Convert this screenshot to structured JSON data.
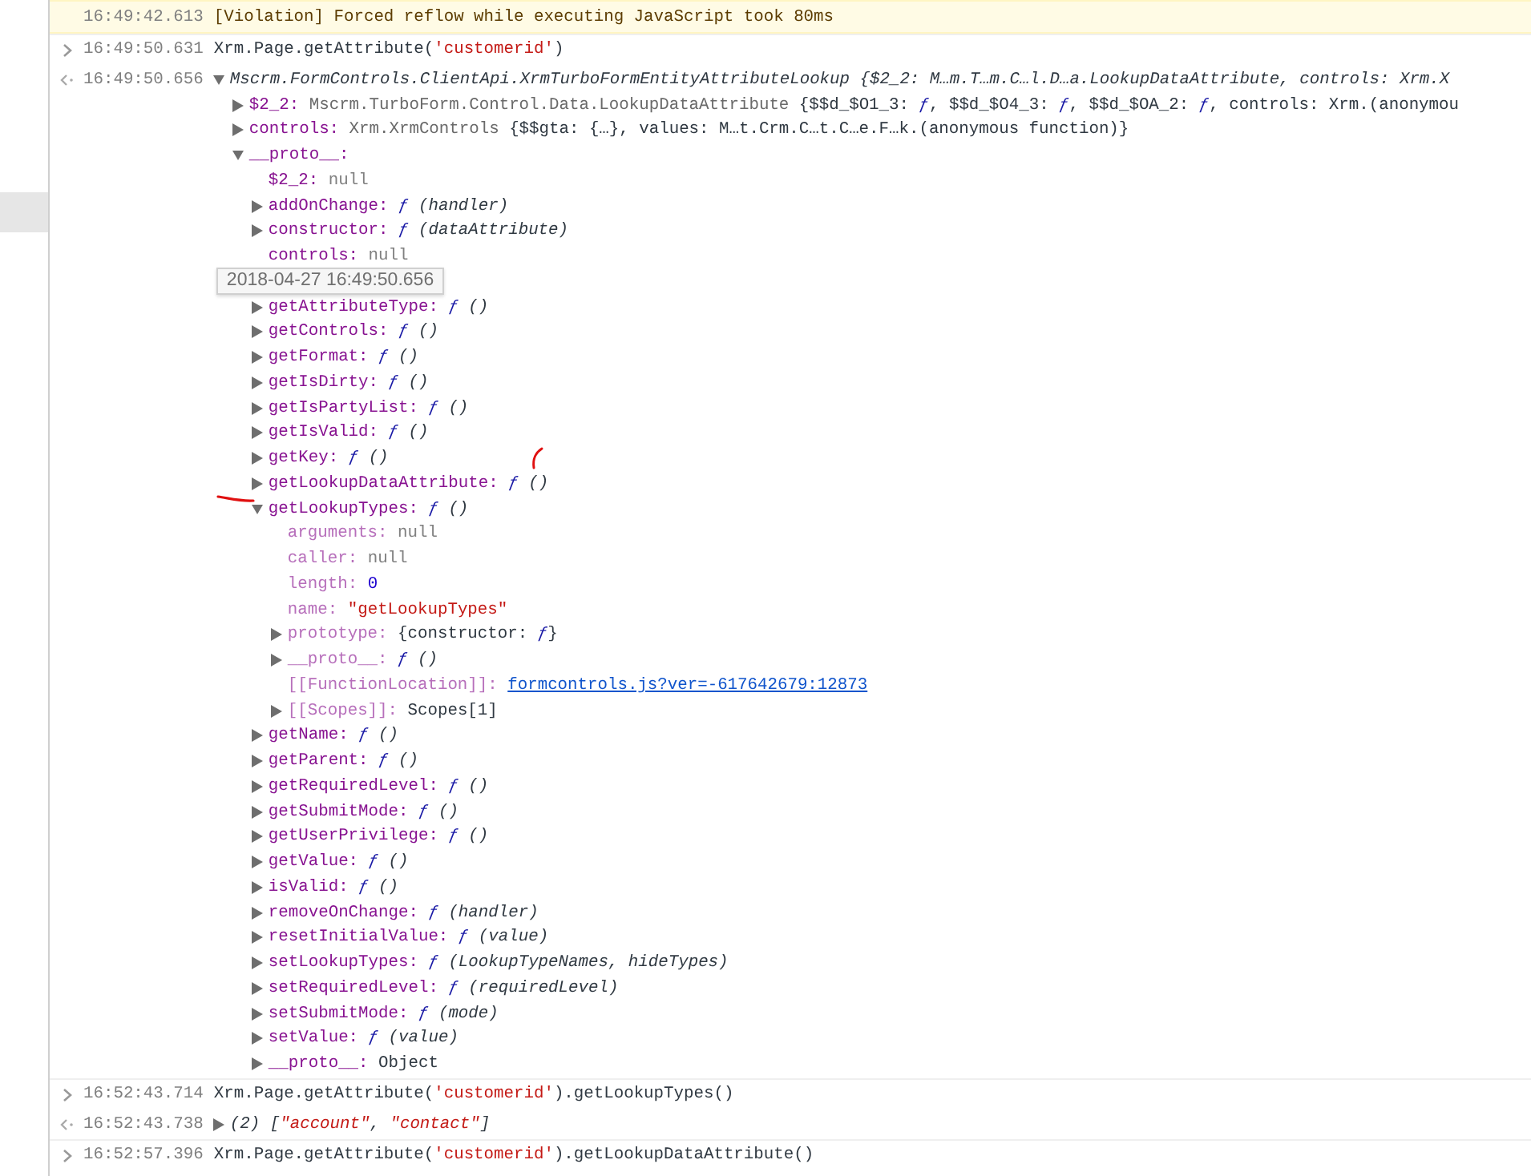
{
  "console": {
    "messages": [
      {
        "kind": "violation",
        "time": "16:49:42.613",
        "tokens": [
          {
            "kind": "plain",
            "text": "[Violation] Forced reflow while executing JavaScript took 80ms"
          }
        ]
      },
      {
        "kind": "input",
        "time": "16:49:50.631",
        "tokens": [
          {
            "kind": "plain",
            "text": "Xrm.Page.getAttribute("
          },
          {
            "kind": "string",
            "text": "'customerid'"
          },
          {
            "kind": "plain",
            "text": ")"
          }
        ]
      },
      {
        "kind": "output",
        "time": "16:49:50.656",
        "tree": {
          "expanded": true,
          "tokens": [
            {
              "kind": "plain",
              "text": "Mscrm.FormControls.ClientApi.XrmTurboFormEntityAttributeLookup {$2_2: M…m.T…m.C…l.D…a.LookupDataAttribute, controls: Xrm.X"
            }
          ],
          "children": [
            {
              "key": "$2_2:",
              "kind": "branch",
              "expanded": false,
              "faint": false,
              "value": [
                {
                  "kind": "class",
                  "text": "Mscrm.TurboForm.Control.Data.LookupDataAttribute"
                },
                {
                  "kind": "plain",
                  "text": " {$$d_$O1_3: "
                },
                {
                  "kind": "fn",
                  "text": "ƒ"
                },
                {
                  "kind": "plain",
                  "text": ", $$d_$O4_3: "
                },
                {
                  "kind": "fn",
                  "text": "ƒ"
                },
                {
                  "kind": "plain",
                  "text": ", $$d_$OA_2: "
                },
                {
                  "kind": "fn",
                  "text": "ƒ"
                },
                {
                  "kind": "plain",
                  "text": ", controls: Xrm.(anonymou"
                }
              ]
            },
            {
              "key": "controls:",
              "kind": "branch",
              "expanded": false,
              "faint": false,
              "value": [
                {
                  "kind": "class",
                  "text": "Xrm.XrmControls"
                },
                {
                  "kind": "plain",
                  "text": " {$$gta: {…}, values: M…t.Crm.C…t.C…e.F…k.(anonymous function)}"
                }
              ]
            },
            {
              "key": "__proto__:",
              "kind": "branch",
              "expanded": true,
              "faint": false,
              "children": [
                {
                  "key": "$2_2:",
                  "kind": "leaf",
                  "faint": false,
                  "value": [
                    {
                      "kind": "null",
                      "text": "null"
                    }
                  ]
                },
                {
                  "key": "addOnChange:",
                  "kind": "branch",
                  "expanded": false,
                  "faint": false,
                  "value": [
                    {
                      "kind": "fn",
                      "text": "ƒ"
                    },
                    {
                      "kind": "params",
                      "text": " (handler)"
                    }
                  ]
                },
                {
                  "key": "constructor:",
                  "kind": "branch",
                  "expanded": false,
                  "faint": false,
                  "value": [
                    {
                      "kind": "fn",
                      "text": "ƒ"
                    },
                    {
                      "kind": "params",
                      "text": " (dataAttribute)"
                    }
                  ]
                },
                {
                  "key": "controls:",
                  "kind": "leaf",
                  "faint": false,
                  "value": [
                    {
                      "kind": "null",
                      "text": "null"
                    }
                  ]
                },
                {
                  "kind": "tooltip",
                  "text": "2018-04-27 16:49:50.656"
                },
                {
                  "key": "getAttributeType:",
                  "kind": "branch",
                  "expanded": false,
                  "faint": false,
                  "value": [
                    {
                      "kind": "fn",
                      "text": "ƒ"
                    },
                    {
                      "kind": "params",
                      "text": " ()"
                    }
                  ]
                },
                {
                  "key": "getControls:",
                  "kind": "branch",
                  "expanded": false,
                  "faint": false,
                  "value": [
                    {
                      "kind": "fn",
                      "text": "ƒ"
                    },
                    {
                      "kind": "params",
                      "text": " ()"
                    }
                  ]
                },
                {
                  "key": "getFormat:",
                  "kind": "branch",
                  "expanded": false,
                  "faint": false,
                  "value": [
                    {
                      "kind": "fn",
                      "text": "ƒ"
                    },
                    {
                      "kind": "params",
                      "text": " ()"
                    }
                  ]
                },
                {
                  "key": "getIsDirty:",
                  "kind": "branch",
                  "expanded": false,
                  "faint": false,
                  "value": [
                    {
                      "kind": "fn",
                      "text": "ƒ"
                    },
                    {
                      "kind": "params",
                      "text": " ()"
                    }
                  ]
                },
                {
                  "key": "getIsPartyList:",
                  "kind": "branch",
                  "expanded": false,
                  "faint": false,
                  "value": [
                    {
                      "kind": "fn",
                      "text": "ƒ"
                    },
                    {
                      "kind": "params",
                      "text": " ()"
                    }
                  ]
                },
                {
                  "key": "getIsValid:",
                  "kind": "branch",
                  "expanded": false,
                  "faint": false,
                  "value": [
                    {
                      "kind": "fn",
                      "text": "ƒ"
                    },
                    {
                      "kind": "params",
                      "text": " ()"
                    }
                  ]
                },
                {
                  "key": "getKey:",
                  "kind": "branch",
                  "expanded": false,
                  "faint": false,
                  "value": [
                    {
                      "kind": "fn",
                      "text": "ƒ"
                    },
                    {
                      "kind": "params",
                      "text": " ()"
                    }
                  ]
                },
                {
                  "key": "getLookupDataAttribute:",
                  "kind": "branch",
                  "expanded": false,
                  "faint": false,
                  "value": [
                    {
                      "kind": "fn",
                      "text": "ƒ"
                    },
                    {
                      "kind": "params",
                      "text": " ()"
                    }
                  ]
                },
                {
                  "key": "getLookupTypes:",
                  "kind": "branch",
                  "expanded": true,
                  "faint": false,
                  "value": [
                    {
                      "kind": "fn",
                      "text": "ƒ"
                    },
                    {
                      "kind": "params",
                      "text": " ()"
                    }
                  ],
                  "children": [
                    {
                      "key": "arguments:",
                      "kind": "leaf",
                      "faint": true,
                      "value": [
                        {
                          "kind": "null",
                          "text": "null"
                        }
                      ]
                    },
                    {
                      "key": "caller:",
                      "kind": "leaf",
                      "faint": true,
                      "value": [
                        {
                          "kind": "null",
                          "text": "null"
                        }
                      ]
                    },
                    {
                      "key": "length:",
                      "kind": "leaf",
                      "faint": true,
                      "value": [
                        {
                          "kind": "number",
                          "text": "0"
                        }
                      ]
                    },
                    {
                      "key": "name:",
                      "kind": "leaf",
                      "faint": true,
                      "value": [
                        {
                          "kind": "string",
                          "text": "\"getLookupTypes\""
                        }
                      ]
                    },
                    {
                      "key": "prototype:",
                      "kind": "branch",
                      "expanded": false,
                      "faint": true,
                      "value": [
                        {
                          "kind": "plain",
                          "text": "{constructor: "
                        },
                        {
                          "kind": "fn",
                          "text": "ƒ"
                        },
                        {
                          "kind": "plain",
                          "text": "}"
                        }
                      ]
                    },
                    {
                      "key": "__proto__:",
                      "kind": "branch",
                      "expanded": false,
                      "faint": true,
                      "value": [
                        {
                          "kind": "fn",
                          "text": "ƒ"
                        },
                        {
                          "kind": "params",
                          "text": " ()"
                        }
                      ]
                    },
                    {
                      "key": "[[FunctionLocation]]:",
                      "kind": "leaf",
                      "faint": true,
                      "value": [
                        {
                          "kind": "link",
                          "text": "formcontrols.js?ver=-617642679:12873"
                        }
                      ]
                    },
                    {
                      "key": "[[Scopes]]:",
                      "kind": "branch",
                      "expanded": false,
                      "faint": true,
                      "value": [
                        {
                          "kind": "plain",
                          "text": "Scopes[1]"
                        }
                      ]
                    }
                  ]
                },
                {
                  "key": "getName:",
                  "kind": "branch",
                  "expanded": false,
                  "faint": false,
                  "value": [
                    {
                      "kind": "fn",
                      "text": "ƒ"
                    },
                    {
                      "kind": "params",
                      "text": " ()"
                    }
                  ]
                },
                {
                  "key": "getParent:",
                  "kind": "branch",
                  "expanded": false,
                  "faint": false,
                  "value": [
                    {
                      "kind": "fn",
                      "text": "ƒ"
                    },
                    {
                      "kind": "params",
                      "text": " ()"
                    }
                  ]
                },
                {
                  "key": "getRequiredLevel:",
                  "kind": "branch",
                  "expanded": false,
                  "faint": false,
                  "value": [
                    {
                      "kind": "fn",
                      "text": "ƒ"
                    },
                    {
                      "kind": "params",
                      "text": " ()"
                    }
                  ]
                },
                {
                  "key": "getSubmitMode:",
                  "kind": "branch",
                  "expanded": false,
                  "faint": false,
                  "value": [
                    {
                      "kind": "fn",
                      "text": "ƒ"
                    },
                    {
                      "kind": "params",
                      "text": " ()"
                    }
                  ]
                },
                {
                  "key": "getUserPrivilege:",
                  "kind": "branch",
                  "expanded": false,
                  "faint": false,
                  "value": [
                    {
                      "kind": "fn",
                      "text": "ƒ"
                    },
                    {
                      "kind": "params",
                      "text": " ()"
                    }
                  ]
                },
                {
                  "key": "getValue:",
                  "kind": "branch",
                  "expanded": false,
                  "faint": false,
                  "value": [
                    {
                      "kind": "fn",
                      "text": "ƒ"
                    },
                    {
                      "kind": "params",
                      "text": " ()"
                    }
                  ]
                },
                {
                  "key": "isValid:",
                  "kind": "branch",
                  "expanded": false,
                  "faint": false,
                  "value": [
                    {
                      "kind": "fn",
                      "text": "ƒ"
                    },
                    {
                      "kind": "params",
                      "text": " ()"
                    }
                  ]
                },
                {
                  "key": "removeOnChange:",
                  "kind": "branch",
                  "expanded": false,
                  "faint": false,
                  "value": [
                    {
                      "kind": "fn",
                      "text": "ƒ"
                    },
                    {
                      "kind": "params",
                      "text": " (handler)"
                    }
                  ]
                },
                {
                  "key": "resetInitialValue:",
                  "kind": "branch",
                  "expanded": false,
                  "faint": false,
                  "value": [
                    {
                      "kind": "fn",
                      "text": "ƒ"
                    },
                    {
                      "kind": "params",
                      "text": " (value)"
                    }
                  ]
                },
                {
                  "key": "setLookupTypes:",
                  "kind": "branch",
                  "expanded": false,
                  "faint": false,
                  "value": [
                    {
                      "kind": "fn",
                      "text": "ƒ"
                    },
                    {
                      "kind": "params",
                      "text": " (LookupTypeNames, hideTypes)"
                    }
                  ]
                },
                {
                  "key": "setRequiredLevel:",
                  "kind": "branch",
                  "expanded": false,
                  "faint": false,
                  "value": [
                    {
                      "kind": "fn",
                      "text": "ƒ"
                    },
                    {
                      "kind": "params",
                      "text": " (requiredLevel)"
                    }
                  ]
                },
                {
                  "key": "setSubmitMode:",
                  "kind": "branch",
                  "expanded": false,
                  "faint": false,
                  "value": [
                    {
                      "kind": "fn",
                      "text": "ƒ"
                    },
                    {
                      "kind": "params",
                      "text": " (mode)"
                    }
                  ]
                },
                {
                  "key": "setValue:",
                  "kind": "branch",
                  "expanded": false,
                  "faint": false,
                  "value": [
                    {
                      "kind": "fn",
                      "text": "ƒ"
                    },
                    {
                      "kind": "params",
                      "text": " (value)"
                    }
                  ]
                },
                {
                  "key": "__proto__:",
                  "kind": "branch",
                  "expanded": false,
                  "faint": false,
                  "value": [
                    {
                      "kind": "plain",
                      "text": "Object"
                    }
                  ]
                }
              ]
            }
          ]
        }
      },
      {
        "kind": "input",
        "time": "16:52:43.714",
        "tokens": [
          {
            "kind": "plain",
            "text": "Xrm.Page.getAttribute("
          },
          {
            "kind": "string",
            "text": "'customerid'"
          },
          {
            "kind": "plain",
            "text": ").getLookupTypes()"
          }
        ]
      },
      {
        "kind": "output",
        "time": "16:52:43.738",
        "tree": {
          "expanded": false,
          "tokens": [
            {
              "kind": "params",
              "text": "(2) ["
            },
            {
              "kind": "string",
              "text": "\"account\""
            },
            {
              "kind": "params",
              "text": ", "
            },
            {
              "kind": "string",
              "text": "\"contact\""
            },
            {
              "kind": "params",
              "text": "]"
            }
          ]
        }
      },
      {
        "kind": "input",
        "time": "16:52:57.396",
        "tokens": [
          {
            "kind": "plain",
            "text": "Xrm.Page.getAttribute("
          },
          {
            "kind": "string",
            "text": "'customerid'"
          },
          {
            "kind": "plain",
            "text": ").getLookupDataAttribute()"
          }
        ]
      }
    ]
  }
}
